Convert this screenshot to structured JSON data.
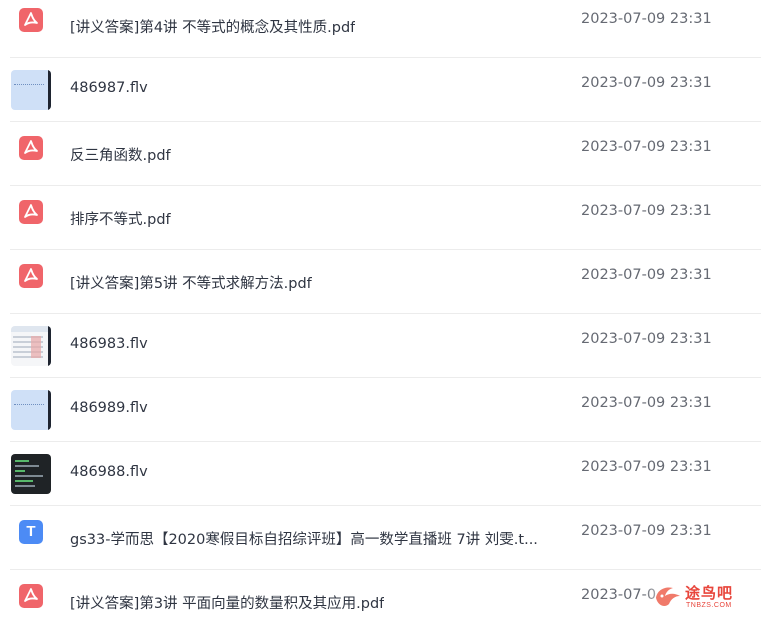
{
  "files": [
    {
      "name": "[讲义答案]第4讲 不等式的概念及其性质.pdf",
      "date": "2023-07-09 23:31",
      "icon": "pdf-icon"
    },
    {
      "name": "486987.flv",
      "date": "2023-07-09 23:31",
      "icon": "video-thumbnail-icon"
    },
    {
      "name": "反三角函数.pdf",
      "date": "2023-07-09 23:31",
      "icon": "pdf-icon"
    },
    {
      "name": "排序不等式.pdf",
      "date": "2023-07-09 23:31",
      "icon": "pdf-icon"
    },
    {
      "name": "[讲义答案]第5讲 不等式求解方法.pdf",
      "date": "2023-07-09 23:31",
      "icon": "pdf-icon"
    },
    {
      "name": "486983.flv",
      "date": "2023-07-09 23:31",
      "icon": "video-thumbnail-icon"
    },
    {
      "name": "486989.flv",
      "date": "2023-07-09 23:31",
      "icon": "video-thumbnail-icon"
    },
    {
      "name": "486988.flv",
      "date": "2023-07-09 23:31",
      "icon": "video-thumbnail-icon"
    },
    {
      "name": "gs33-学而思【2020寒假目标自招综评班】高一数学直播班 7讲 刘雯.t...",
      "date": "2023-07-09 23:31",
      "icon": "text-file-icon"
    },
    {
      "name": "[讲义答案]第3讲 平面向量的数量积及其应用.pdf",
      "date": "2023-07-0",
      "icon": "pdf-icon"
    }
  ],
  "watermark": {
    "text": "途鸟吧",
    "sub": "TNBZS.COM"
  },
  "colors": {
    "pdf": "#f0656a",
    "text_file": "#4c8bf5",
    "watermark": "#e8463c"
  }
}
